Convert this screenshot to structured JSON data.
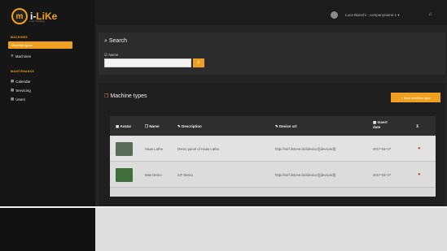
{
  "brand": {
    "logo_letter": "m",
    "name_prefix": "i-",
    "name_highlight": "LiKe",
    "tagline": "Lean Thinking"
  },
  "sidebar": {
    "sections": [
      {
        "title": "MACHINES",
        "items": [
          {
            "label": "Machine types",
            "active": true
          },
          {
            "label": "Machines",
            "icon": "cogs-icon"
          }
        ]
      },
      {
        "title": "MAINTENANCE",
        "items": [
          {
            "label": "Calendar",
            "icon": "calendar-icon"
          },
          {
            "label": "Servicing",
            "icon": "wrench-icon"
          },
          {
            "label": "Users",
            "icon": "users-icon"
          }
        ]
      }
    ]
  },
  "topbar": {
    "user": "Luca Bianchi - companyname 1",
    "caret": "▾"
  },
  "search": {
    "title": "Search",
    "name_label": "Name",
    "name_value": "",
    "button_icon": "search-icon"
  },
  "machine_types": {
    "title": "Machine types",
    "new_button": "+ New machine type",
    "columns": [
      "Avatar",
      "Name",
      "Description",
      "Device url",
      "Insert date",
      ""
    ],
    "rows": [
      {
        "name": "Haas Lathe",
        "description": "Demo panel of Haas Lathe",
        "device_url": "http://ssrf.ilstone.biz/device/{{deviceId}}",
        "insert_date": "2017-02-17"
      },
      {
        "name": "Mas Demo",
        "description": "IoT Demo",
        "device_url": "http://ssrf.ilstone.biz/device/{{deviceId}}",
        "insert_date": "2017-02-17"
      }
    ]
  },
  "colors": {
    "accent": "#f0a020",
    "sidebar": "#161616",
    "content": "#242424"
  }
}
